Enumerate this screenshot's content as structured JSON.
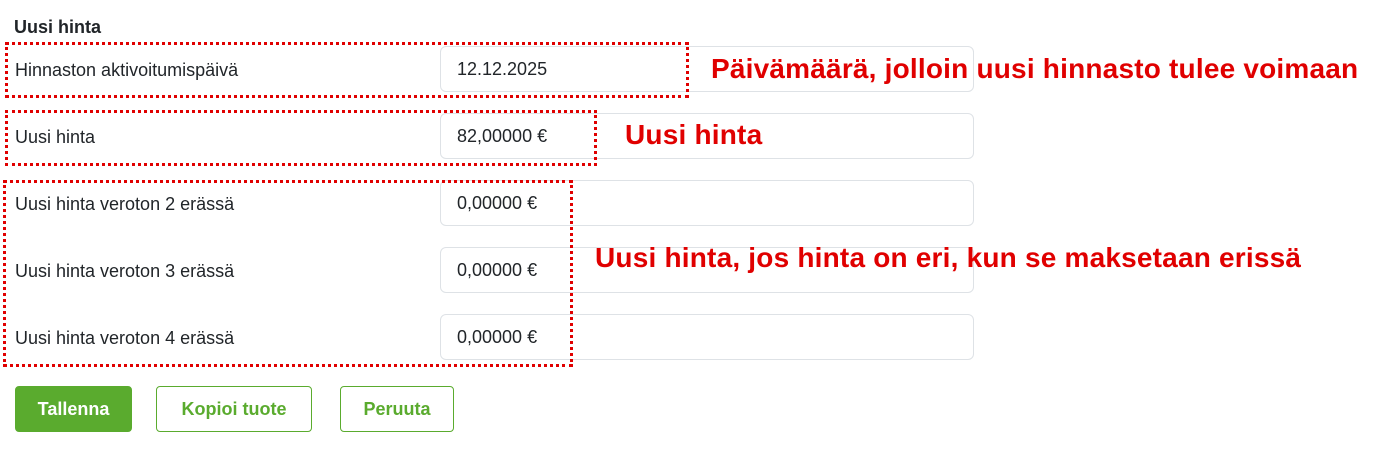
{
  "section": {
    "title": "Uusi hinta"
  },
  "fields": [
    {
      "label": "Hinnaston aktivoitumispäivä",
      "value": "12.12.2025"
    },
    {
      "label": "Uusi hinta",
      "value": "82,00000 €"
    },
    {
      "label": "Uusi hinta veroton 2 erässä",
      "value": "0,00000 €"
    },
    {
      "label": "Uusi hinta veroton 3 erässä",
      "value": "0,00000 €"
    },
    {
      "label": "Uusi hinta veroton 4 erässä",
      "value": "0,00000 €"
    }
  ],
  "annotations": {
    "activation_date": "Päivämäärä, jolloin uusi hinnasto tulee voimaan",
    "new_price": "Uusi hinta",
    "installments": "Uusi hinta, jos hinta on eri, kun se maksetaan erissä",
    "color": "#e00000"
  },
  "buttons": {
    "save": "Tallenna",
    "copy": "Kopioi tuote",
    "cancel": "Peruuta"
  },
  "colors": {
    "accent": "#5aab2e",
    "annotation": "#e00000"
  }
}
